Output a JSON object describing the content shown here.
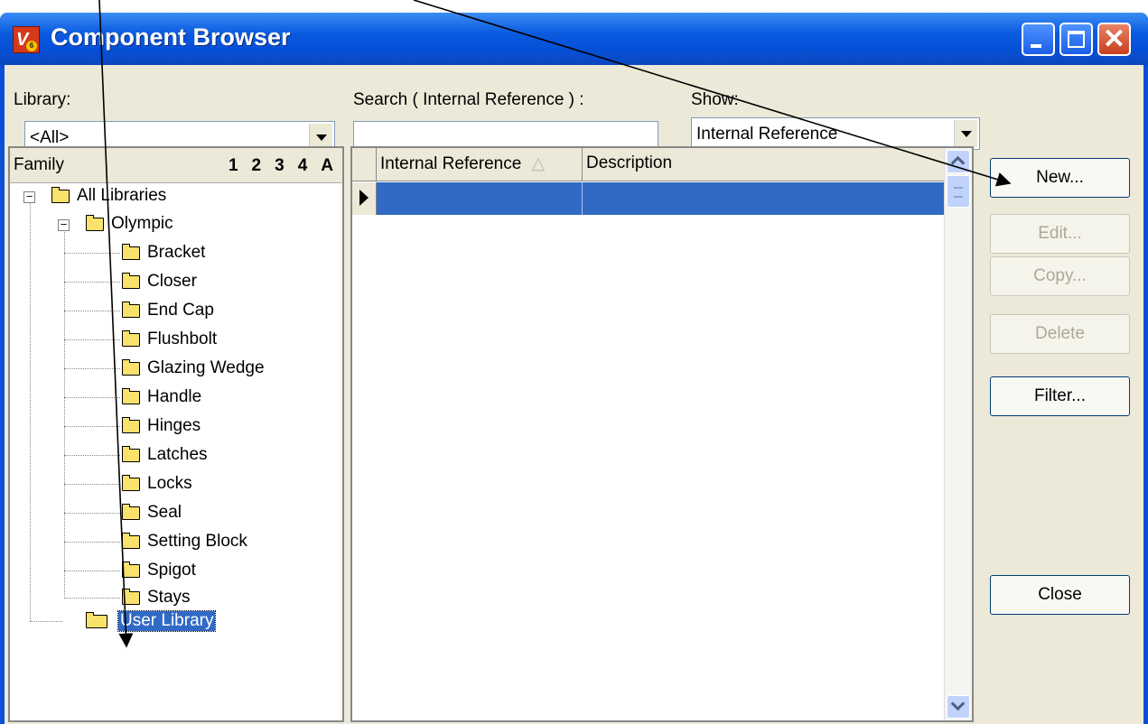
{
  "window": {
    "title": "Component Browser",
    "icon": "app-logo-icon",
    "icon_text": "V",
    "icon_badge": "6"
  },
  "filters": {
    "library_label": "Library:",
    "library_value": "<All>",
    "search_label": "Search ( Internal Reference ) :",
    "search_value": "",
    "show_label": "Show:",
    "show_value": "Internal Reference"
  },
  "family": {
    "header": "Family",
    "levels": [
      "1",
      "2",
      "3",
      "4",
      "A"
    ],
    "tree": {
      "root": "All Libraries",
      "library": "Olympic",
      "items": [
        "Bracket",
        "Closer",
        "End Cap",
        "Flushbolt",
        "Glazing Wedge",
        "Handle",
        "Hinges",
        "Latches",
        "Locks",
        "Seal",
        "Setting Block",
        "Spigot",
        "Stays"
      ],
      "user_library": "User Library"
    }
  },
  "grid": {
    "columns": [
      "Internal Reference",
      "Description"
    ],
    "sort_indicator": "△"
  },
  "buttons": {
    "new": "New...",
    "edit": "Edit...",
    "copy": "Copy...",
    "delete": "Delete",
    "filter": "Filter...",
    "close": "Close"
  },
  "colors": {
    "titlebar": "#0a5ae0",
    "selection": "#316ac5",
    "dialog_bg": "#ece9d8"
  }
}
